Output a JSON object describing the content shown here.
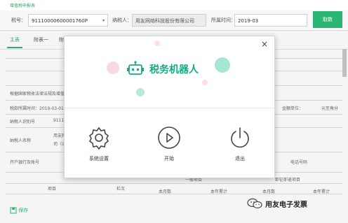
{
  "header": {
    "title": "增值税申报表"
  },
  "form": {
    "tax_no_label": "税号：",
    "tax_no_value": "91110000600001760P",
    "taxpayer_label": "纳税人：",
    "taxpayer_value": "用友网络科技股份有限公司",
    "period_label": "所属时间：",
    "period_value": "2019-03",
    "cancel_label": "取数"
  },
  "tabs": [
    {
      "label": "主表"
    },
    {
      "label": "附表一"
    },
    {
      "label": "附"
    }
  ],
  "background_table": {
    "law_text": "根据国家税收法律法规及增值税",
    "period_text": "税款所属时间：2019-03-01 至",
    "amount_unit_label": "金额单位：",
    "amount_unit_value": "元至角分",
    "taxpayer_id_label": "纳税人识别号",
    "taxpayer_id_value": "9111",
    "taxpayer_name_label": "纳税人名称",
    "taxpayer_name_value": "用友网",
    "taxpayer_name_value2": "司（公",
    "bank_label": "开户银行及账号",
    "phone_label": "电话号码",
    "col_item": "项目",
    "col_rank": "栏次",
    "col_general": "一般项目",
    "col_immediate": "即征即退项目",
    "col_month": "本月数",
    "col_cumulative": "本年累计",
    "col_month2": "本月数",
    "col_cumulative2": "本年累计"
  },
  "modal": {
    "title": "税务机器人",
    "close_glyph": "×",
    "actions": [
      {
        "label": "系统设置",
        "icon": "gear-icon"
      },
      {
        "label": "开始",
        "icon": "play-icon"
      },
      {
        "label": "退出",
        "icon": "power-icon"
      }
    ],
    "accent_color": "#1aa884"
  },
  "bottom": {
    "save_label": "保存"
  },
  "watermark": {
    "text": "用友电子发票"
  }
}
